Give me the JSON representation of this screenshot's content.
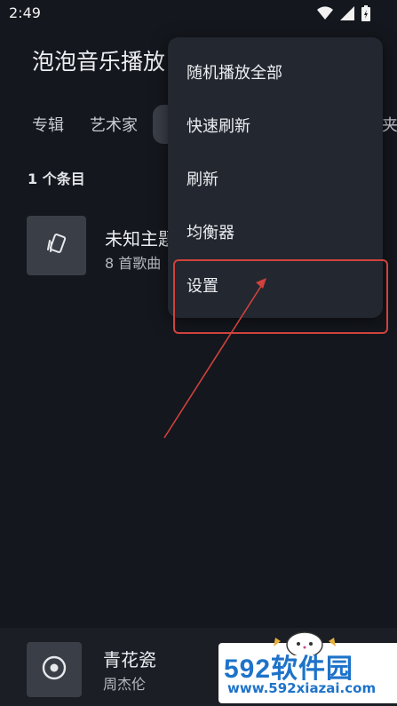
{
  "status_bar": {
    "time": "2:49",
    "icons": [
      "wifi-icon",
      "signal-icon",
      "battery-icon"
    ]
  },
  "app_bar": {
    "title": "泡泡音乐播放"
  },
  "tabs": [
    {
      "label": "专辑"
    },
    {
      "label": "艺术家"
    },
    {
      "label": "夹"
    }
  ],
  "content": {
    "item_count": "1 个条目",
    "list": [
      {
        "title": "未知主题",
        "subtitle": "8 首歌曲"
      }
    ]
  },
  "menu": {
    "items": [
      {
        "label": "随机播放全部"
      },
      {
        "label": "快速刷新"
      },
      {
        "label": "刷新"
      },
      {
        "label": "均衡器"
      },
      {
        "label": "设置"
      }
    ]
  },
  "mini_player": {
    "title": "青花瓷",
    "artist": "周杰伦"
  },
  "watermark": {
    "brand": "592软件园",
    "url": "www.592xiazai.com"
  },
  "colors": {
    "background": "#14171d",
    "menu_background": "#23272f",
    "annotation_red": "#d0423d",
    "watermark_blue": "#1e73c9"
  }
}
